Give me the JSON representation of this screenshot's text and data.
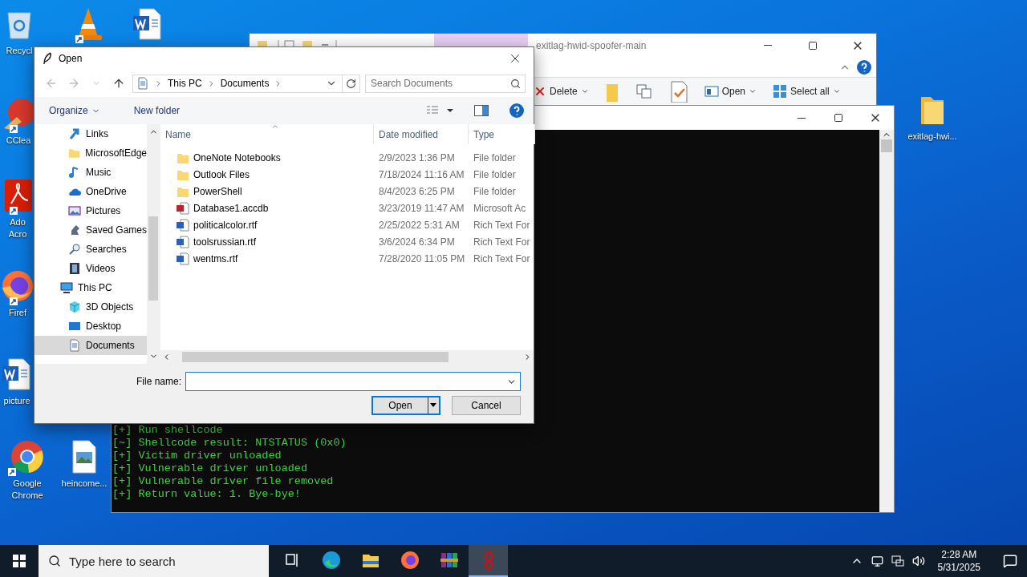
{
  "desktop": {
    "icons": [
      {
        "kind": "recycle-bin",
        "label": "Recycl"
      },
      {
        "kind": "cone"
      },
      {
        "kind": "word-doc"
      },
      {
        "kind": "ccleaner",
        "label": "CClea"
      },
      {
        "kind": "acrobat",
        "label": "Ado Acro"
      },
      {
        "kind": "firefox",
        "label": "Firef"
      },
      {
        "kind": "word-doc",
        "label": "picture"
      },
      {
        "kind": "chrome",
        "label": "Google Chrome"
      },
      {
        "kind": "image-file",
        "label": "heincome..."
      },
      {
        "kind": "folder",
        "label": "exitlag-hwi..."
      }
    ]
  },
  "explorer_window": {
    "title": "exitlag-hwid-spoofer-main",
    "ribbon": [
      {
        "kind": "delete",
        "label": "Delete"
      },
      {
        "kind": "folder"
      },
      {
        "kind": "copy"
      },
      {
        "kind": "properties"
      },
      {
        "kind": "open",
        "label": "Open"
      },
      {
        "kind": "select-all",
        "label": "Select all"
      }
    ]
  },
  "console_window": {
    "lines": [
      "[+] Run shellcode",
      "[~] Shellcode result: NTSTATUS (0x0)",
      "[+] Victim driver unloaded",
      "[+] Vulnerable driver unloaded",
      "[+] Vulnerable driver file removed",
      "[+] Return value: 1. Bye-bye!"
    ]
  },
  "open_dialog": {
    "title": "Open",
    "breadcrumb": [
      "This PC",
      "Documents"
    ],
    "search": {
      "placeholder": "Search Documents"
    },
    "toolbar": {
      "organize": "Organize",
      "new_folder": "New folder"
    },
    "navigation": [
      {
        "kind": "links",
        "label": "Links",
        "selected": false
      },
      {
        "kind": "folder",
        "label": "MicrosoftEdge",
        "selected": false
      },
      {
        "kind": "music",
        "label": "Music",
        "selected": false
      },
      {
        "kind": "cloud",
        "label": "OneDrive",
        "selected": false
      },
      {
        "kind": "pictures",
        "label": "Pictures",
        "selected": false
      },
      {
        "kind": "games",
        "label": "Saved Games",
        "selected": false
      },
      {
        "kind": "search",
        "label": "Searches",
        "selected": false
      },
      {
        "kind": "videos",
        "label": "Videos",
        "selected": false
      },
      {
        "kind": "pc",
        "label": "This PC",
        "selected": false,
        "children": [
          {
            "kind": "cube",
            "label": "3D Objects",
            "selected": false
          },
          {
            "kind": "desktop",
            "label": "Desktop",
            "selected": false
          },
          {
            "kind": "documents",
            "label": "Documents",
            "selected": true
          }
        ]
      }
    ],
    "columns": [
      "Name",
      "Date modified",
      "Type"
    ],
    "files": [
      {
        "kind": "folder",
        "name": "OneNote Notebooks",
        "date": "2/9/2023 1:36 PM",
        "type": "File folder"
      },
      {
        "kind": "folder",
        "name": "Outlook Files",
        "date": "7/18/2024 11:16 AM",
        "type": "File folder"
      },
      {
        "kind": "folder",
        "name": "PowerShell",
        "date": "8/4/2023 6:25 PM",
        "type": "File folder"
      },
      {
        "kind": "access",
        "name": "Database1.accdb",
        "date": "3/23/2019 11:47 AM",
        "type": "Microsoft Ac"
      },
      {
        "kind": "rtf",
        "name": "politicalcolor.rtf",
        "date": "2/25/2022 5:31 AM",
        "type": "Rich Text For"
      },
      {
        "kind": "rtf",
        "name": "toolsrussian.rtf",
        "date": "3/6/2024 6:34 PM",
        "type": "Rich Text For"
      },
      {
        "kind": "rtf",
        "name": "wentms.rtf",
        "date": "7/28/2020 11:05 PM",
        "type": "Rich Text For"
      }
    ],
    "file_name": {
      "label": "File name:"
    },
    "buttons": {
      "open": "Open",
      "cancel": "Cancel"
    }
  },
  "taskbar": {
    "search": {
      "placeholder": "Type here to search"
    },
    "apps": [
      {
        "kind": "task-view",
        "active": false
      },
      {
        "kind": "edge",
        "active": false
      },
      {
        "kind": "file-explorer",
        "active": false
      },
      {
        "kind": "firefox",
        "active": false
      },
      {
        "kind": "winrar",
        "active": false
      },
      {
        "kind": "red-app",
        "active": true
      }
    ],
    "clock": {
      "time": "2:28 AM",
      "date": "5/31/2025"
    }
  }
}
